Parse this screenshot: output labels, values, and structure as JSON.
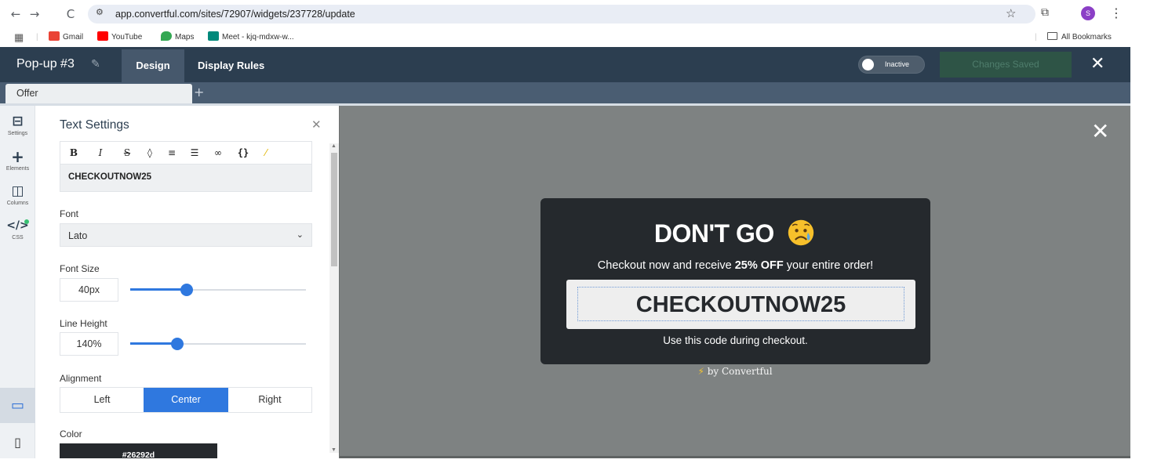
{
  "browser": {
    "back_icon": "←",
    "forward_icon": "→",
    "reload_icon": "C",
    "url": "app.convertful.com/sites/72907/widgets/237728/update",
    "profile_initial": "S",
    "bookmarks": [
      {
        "label": "Gmail",
        "color": "#ea4335"
      },
      {
        "label": "YouTube",
        "color": "#ff0000"
      },
      {
        "label": "Maps",
        "color": "#34a853"
      },
      {
        "label": "Meet - kjq-mdxw-w...",
        "color": "#00897b"
      }
    ],
    "all_bookmarks": "All Bookmarks"
  },
  "header": {
    "title": "Pop-up #3",
    "tabs": [
      "Design",
      "Display Rules"
    ],
    "status_label": "Inactive",
    "save_label": "Changes Saved"
  },
  "subtabs": {
    "active": "Offer",
    "add": "+"
  },
  "rail": {
    "items": [
      {
        "label": "Settings",
        "icon": "settings-icon"
      },
      {
        "label": "Elements",
        "icon": "plus-icon"
      },
      {
        "label": "Columns",
        "icon": "columns-icon"
      },
      {
        "label": "CSS",
        "icon": "code-icon"
      }
    ]
  },
  "panel": {
    "title": "Text Settings",
    "editor_text": "CHECKOUTNOW25",
    "font_label": "Font",
    "font_value": "Lato",
    "font_size_label": "Font Size",
    "font_size_value": "40px",
    "font_size_level": 0.32,
    "line_height_label": "Line Height",
    "line_height_value": "140%",
    "line_height_level": 0.27,
    "alignment_label": "Alignment",
    "alignment_options": [
      "Left",
      "Center",
      "Right"
    ],
    "alignment_selected": "Center",
    "color_label": "Color",
    "color_value": "#26292d"
  },
  "popup": {
    "heading": "DON'T GO",
    "sub_prefix": "Checkout now and receive ",
    "sub_bold": "25% OFF",
    "sub_suffix": " your entire order!",
    "code": "CHECKOUTNOW25",
    "note": "Use this code during checkout.",
    "branding": "by Convertful"
  },
  "colors": {
    "header_bg": "#2c3e50",
    "accent": "#2f78df",
    "popup_bg": "#25292d",
    "canvas_bg": "#7e8282"
  }
}
